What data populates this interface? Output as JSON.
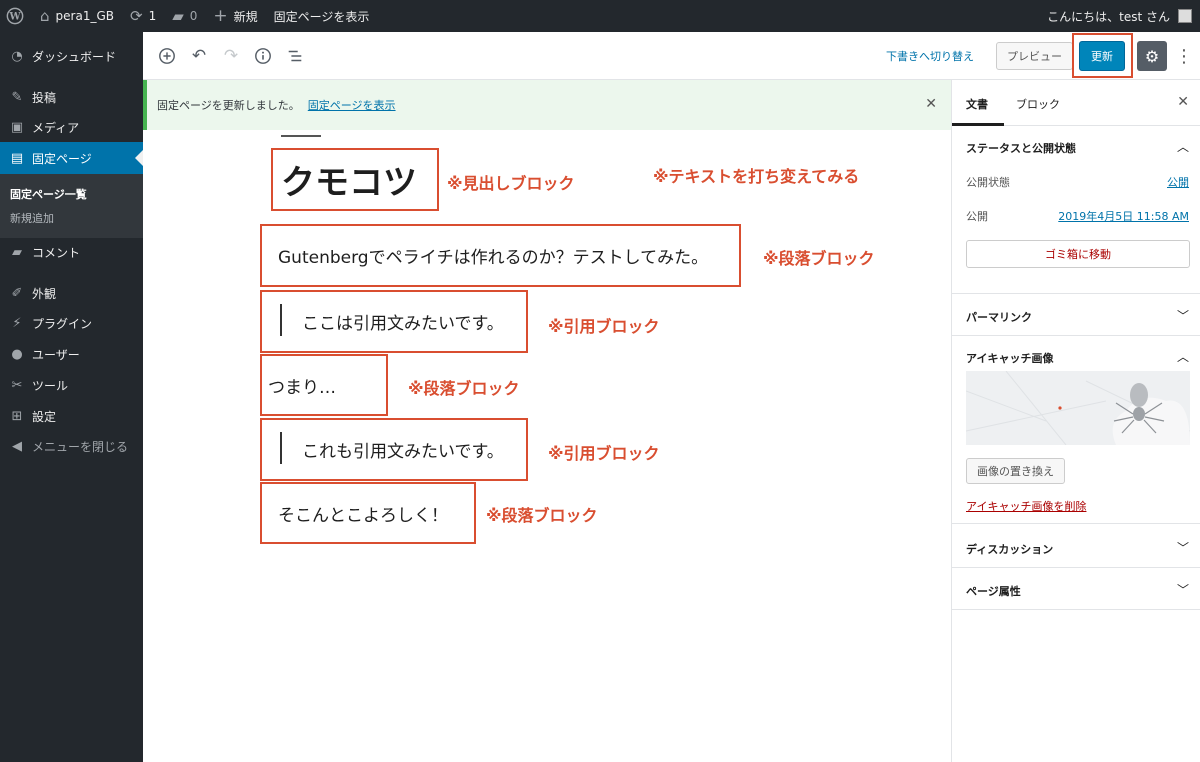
{
  "adminbar": {
    "site_name": "pera1_GB",
    "updates_count": "1",
    "comments_count": "0",
    "new_label": "新規",
    "view_page": "固定ページを表示",
    "greeting": "こんにちは、test さん"
  },
  "sidebar": {
    "items": [
      {
        "label": "ダッシュボード",
        "icon": "dashboard-icon"
      },
      {
        "label": "投稿",
        "icon": "pin-icon"
      },
      {
        "label": "メディア",
        "icon": "media-icon"
      },
      {
        "label": "固定ページ",
        "icon": "page-icon"
      },
      {
        "label": "コメント",
        "icon": "comment-icon"
      },
      {
        "label": "外観",
        "icon": "appearance-icon"
      },
      {
        "label": "プラグイン",
        "icon": "plugin-icon"
      },
      {
        "label": "ユーザー",
        "icon": "user-icon"
      },
      {
        "label": "ツール",
        "icon": "tools-icon"
      },
      {
        "label": "設定",
        "icon": "settings-icon"
      },
      {
        "label": "メニューを閉じる",
        "icon": "collapse-icon"
      }
    ],
    "submenu": [
      "固定ページ一覧",
      "新規追加"
    ]
  },
  "header": {
    "switch_draft": "下書きへ切り替え",
    "preview": "プレビュー",
    "update": "更新"
  },
  "notice": {
    "message": "固定ページを更新しました。",
    "link": "固定ページを表示"
  },
  "blocks": {
    "heading": "クモコツ",
    "para1": "Gutenbergでペライチは作れるのか？テストしてみた。",
    "quote1": "ここは引用文みたいです。",
    "para2": "つまり…",
    "quote2": "これも引用文みたいです。",
    "para3": "そこんとこよろしく！"
  },
  "annotations": {
    "heading": "※見出しブロック",
    "text_change": "※テキストを打ち変えてみる",
    "para1": "※段落ブロック",
    "quote1": "※引用ブロック",
    "para2": "※段落ブロック",
    "quote2": "※引用ブロック",
    "para3": "※段落ブロック"
  },
  "panel": {
    "tab_document": "文書",
    "tab_block": "ブロック",
    "status_title": "ステータスと公開状態",
    "visibility_label": "公開状態",
    "visibility_value": "公開",
    "publish_label": "公開",
    "publish_value": "2019年4月5日 11:58 AM",
    "trash": "ゴミ箱に移動",
    "permalink": "パーマリンク",
    "featured_title": "アイキャッチ画像",
    "replace_image": "画像の置き換え",
    "remove_image": "アイキャッチ画像を削除",
    "discussion": "ディスカッション",
    "page_attributes": "ページ属性"
  },
  "colors": {
    "annotation": "#d94e30",
    "admin_dark": "#23282d",
    "accent": "#0073aa"
  }
}
